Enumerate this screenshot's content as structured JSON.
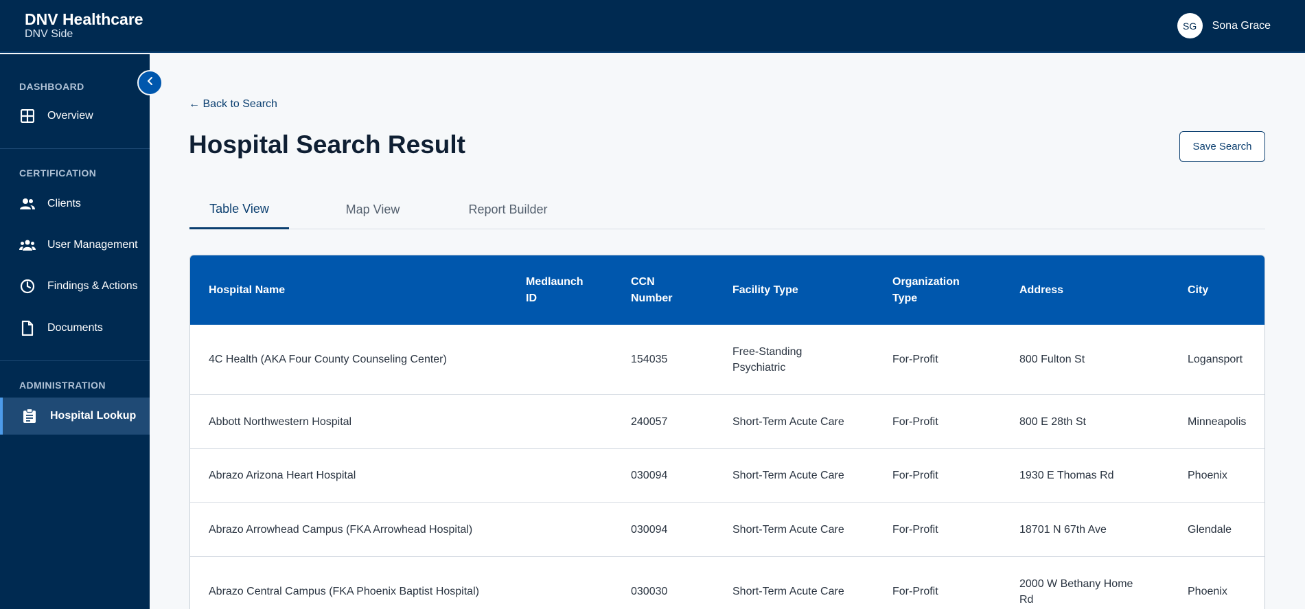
{
  "header": {
    "brand_title": "DNV Healthcare",
    "brand_subtitle": "DNV Side",
    "user_initials": "SG",
    "user_name": "Sona Grace"
  },
  "sidebar": {
    "sections": [
      {
        "label": "DASHBOARD",
        "items": [
          {
            "label": "Overview",
            "icon": "grid-icon"
          }
        ]
      },
      {
        "label": "CERTIFICATION",
        "items": [
          {
            "label": "Clients",
            "icon": "users-icon"
          },
          {
            "label": "User Management",
            "icon": "group-icon"
          },
          {
            "label": "Findings & Actions",
            "icon": "clock-icon"
          },
          {
            "label": "Documents",
            "icon": "document-icon"
          }
        ]
      },
      {
        "label": "ADMINISTRATION",
        "items": [
          {
            "label": "Hospital Lookup",
            "icon": "clipboard-icon",
            "active": true
          }
        ]
      }
    ]
  },
  "main": {
    "back_label": "← Back to Search",
    "title": "Hospital Search Result",
    "save_label": "Save Search",
    "tabs": [
      {
        "label": "Table View",
        "active": true
      },
      {
        "label": "Map View"
      },
      {
        "label": "Report Builder"
      }
    ]
  },
  "table": {
    "columns": [
      "Hospital Name",
      "Medlaunch ID",
      "CCN Number",
      "Facility Type",
      "Organization Type",
      "Address",
      "City"
    ],
    "rows": [
      [
        "4C Health (AKA Four County Counseling Center)",
        "",
        "154035",
        "Free-Standing Psychiatric",
        "For-Profit",
        "800 Fulton St",
        "Logansport"
      ],
      [
        "Abbott Northwestern Hospital",
        "",
        "240057",
        "Short-Term Acute Care",
        "For-Profit",
        "800 E 28th St",
        "Minneapolis"
      ],
      [
        "Abrazo Arizona Heart Hospital",
        "",
        "030094",
        "Short-Term Acute Care",
        "For-Profit",
        "1930 E Thomas Rd",
        "Phoenix"
      ],
      [
        "Abrazo Arrowhead Campus (FKA Arrowhead Hospital)",
        "",
        "030094",
        "Short-Term Acute Care",
        "For-Profit",
        "18701 N 67th Ave",
        "Glendale"
      ],
      [
        "Abrazo Central Campus (FKA Phoenix Baptist Hospital)",
        "",
        "030030",
        "Short-Term Acute Care",
        "For-Profit",
        "2000 W Bethany Home Rd",
        "Phoenix"
      ]
    ]
  },
  "colors": {
    "navy": "#002a51",
    "accent_blue": "#0057ad",
    "active_indicator": "#4d9bea"
  }
}
